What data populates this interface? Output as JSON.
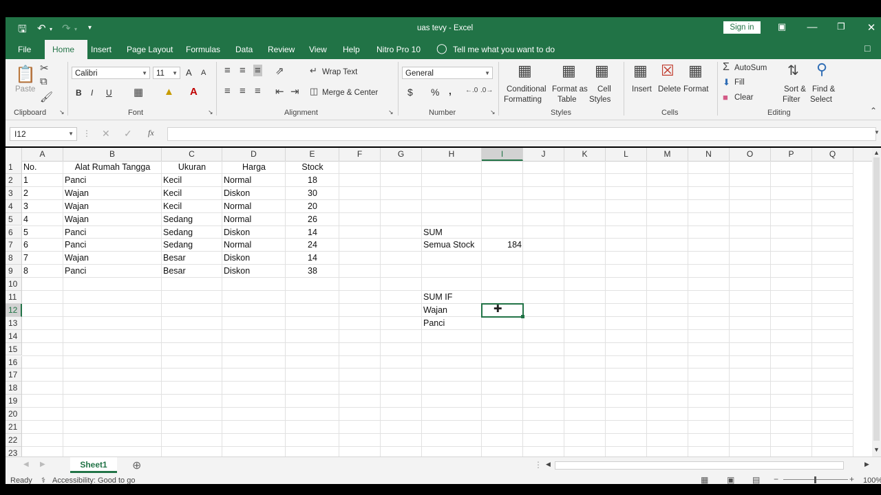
{
  "app": {
    "title": "uas tevy  -  Excel",
    "sign_in": "Sign in"
  },
  "tabs": [
    "File",
    "Home",
    "Insert",
    "Page Layout",
    "Formulas",
    "Data",
    "Review",
    "View",
    "Help",
    "Nitro Pro 10"
  ],
  "tell_me": "Tell me what you want to do",
  "ribbon": {
    "clipboard": {
      "paste": "Paste",
      "label": "Clipboard"
    },
    "font": {
      "name": "Calibri",
      "size": "11",
      "bold": "B",
      "italic": "I",
      "underline": "U",
      "grow": "A",
      "shrink": "A",
      "label": "Font"
    },
    "alignment": {
      "wrap": "Wrap Text",
      "merge": "Merge & Center",
      "label": "Alignment"
    },
    "number": {
      "format": "General",
      "currency": "$",
      "percent": "%",
      "comma": ",",
      "label": "Number"
    },
    "styles": {
      "conditional_1": "Conditional",
      "conditional_2": "Formatting",
      "format_table_1": "Format as",
      "format_table_2": "Table",
      "cell_styles_1": "Cell",
      "cell_styles_2": "Styles",
      "label": "Styles"
    },
    "cells": {
      "insert": "Insert",
      "delete": "Delete",
      "format": "Format",
      "label": "Cells"
    },
    "editing": {
      "autosum": "AutoSum",
      "fill": "Fill",
      "clear": "Clear",
      "sort_1": "Sort &",
      "sort_2": "Filter",
      "find_1": "Find &",
      "find_2": "Select",
      "label": "Editing"
    }
  },
  "formula_bar": {
    "name_box": "I12",
    "fx": "fx",
    "value": ""
  },
  "columns": [
    "A",
    "B",
    "C",
    "D",
    "E",
    "F",
    "G",
    "H",
    "I",
    "J",
    "K",
    "L",
    "M",
    "N",
    "O",
    "P",
    "Q"
  ],
  "rows": [
    "1",
    "2",
    "3",
    "4",
    "5",
    "6",
    "7",
    "8",
    "9",
    "10",
    "11",
    "12",
    "13",
    "14",
    "15",
    "16",
    "17",
    "18",
    "19",
    "20",
    "21",
    "22",
    "23"
  ],
  "table": {
    "headers": [
      "No.",
      "Alat Rumah Tangga",
      "Ukuran",
      "Harga",
      "Stock"
    ],
    "rows": [
      [
        "1",
        "Panci",
        "Kecil",
        "Normal",
        "18"
      ],
      [
        "2",
        "Wajan",
        "Kecil",
        "Diskon",
        "30"
      ],
      [
        "3",
        "Wajan",
        "Kecil",
        "Normal",
        "20"
      ],
      [
        "4",
        "Wajan",
        "Sedang",
        "Normal",
        "26"
      ],
      [
        "5",
        "Panci",
        "Sedang",
        "Diskon",
        "14"
      ],
      [
        "6",
        "Panci",
        "Sedang",
        "Normal",
        "24"
      ],
      [
        "7",
        "Wajan",
        "Besar",
        "Diskon",
        "14"
      ],
      [
        "8",
        "Panci",
        "Besar",
        "Diskon",
        "38"
      ]
    ]
  },
  "side": {
    "sum": "SUM",
    "semua_stock": "Semua Stock",
    "semua_stock_value": "184",
    "sumif": "SUM IF",
    "wajan": "Wajan",
    "panci": "Panci"
  },
  "sheet": {
    "name": "Sheet1"
  },
  "status": {
    "ready": "Ready",
    "accessibility": "Accessibility: Good to go",
    "zoom": "100%"
  },
  "colors": {
    "excel_green": "#217346",
    "ribbon_bg": "#f3f3f3"
  }
}
